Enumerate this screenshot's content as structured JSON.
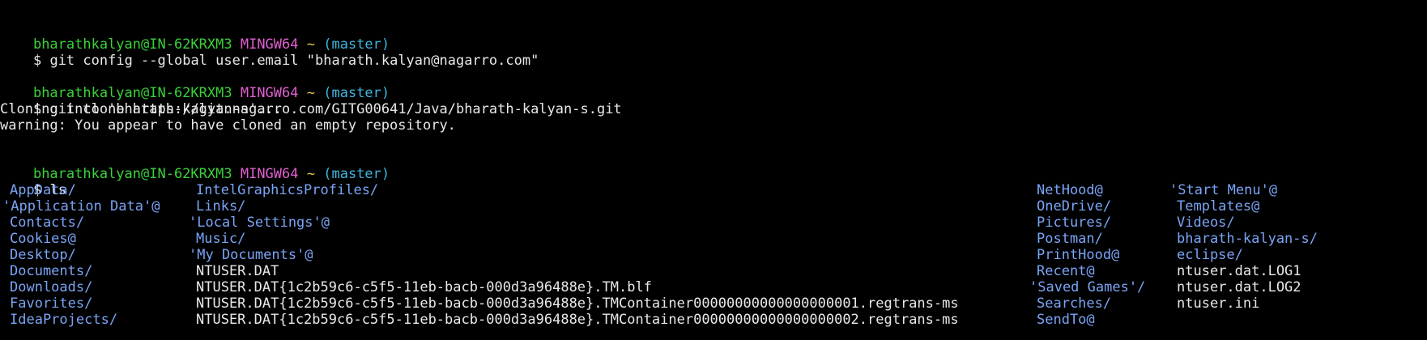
{
  "colors": {
    "background": "#000000",
    "user_host": "#3ad13a",
    "mingw": "#e05fcf",
    "tilde": "#e6c64f",
    "branch": "#3fb6e0",
    "text": "#e8e8e8",
    "directory": "#7aa4f5"
  },
  "prompt": {
    "user_host": "bharathkalyan@IN-62KRXM3",
    "env": "MINGW64",
    "path": "~",
    "branch": "(master)",
    "symbol": "$"
  },
  "commands": [
    {
      "cmd": "git config --global user.email \"bharath.kalyan@nagarro.com\"",
      "output": []
    },
    {
      "cmd": "git clone https://git.nagarro.com/GITG00641/Java/bharath-kalyan-s.git",
      "output": [
        "Cloning into 'bharath-kalyan-s'...",
        "warning: You appear to have cloned an empty repository."
      ]
    },
    {
      "cmd": "ls",
      "output": []
    }
  ],
  "ls_columns": [
    [
      "AppData/",
      "'Application Data'@",
      "Contacts/",
      "Cookies@",
      "Desktop/",
      "Documents/",
      "Downloads/",
      "Favorites/",
      "IdeaProjects/"
    ],
    [
      "IntelGraphicsProfiles/",
      "Links/",
      "'Local Settings'@",
      "Music/",
      "'My Documents'@",
      "NTUSER.DAT",
      "NTUSER.DAT{1c2b59c6-c5f5-11eb-bacb-000d3a96488e}.TM.blf",
      "NTUSER.DAT{1c2b59c6-c5f5-11eb-bacb-000d3a96488e}.TMContainer00000000000000000001.regtrans-ms",
      "NTUSER.DAT{1c2b59c6-c5f5-11eb-bacb-000d3a96488e}.TMContainer00000000000000000002.regtrans-ms"
    ],
    [
      "NetHood@",
      "OneDrive/",
      "Pictures/",
      "Postman/",
      "PrintHood@",
      "Recent@",
      "'Saved Games'/",
      "Searches/",
      "SendTo@"
    ],
    [
      "'Start Menu'@",
      "Templates@",
      "Videos/",
      "bharath-kalyan-s/",
      "eclipse/",
      "ntuser.dat.LOG1",
      "ntuser.dat.LOG2",
      "ntuser.ini"
    ]
  ]
}
